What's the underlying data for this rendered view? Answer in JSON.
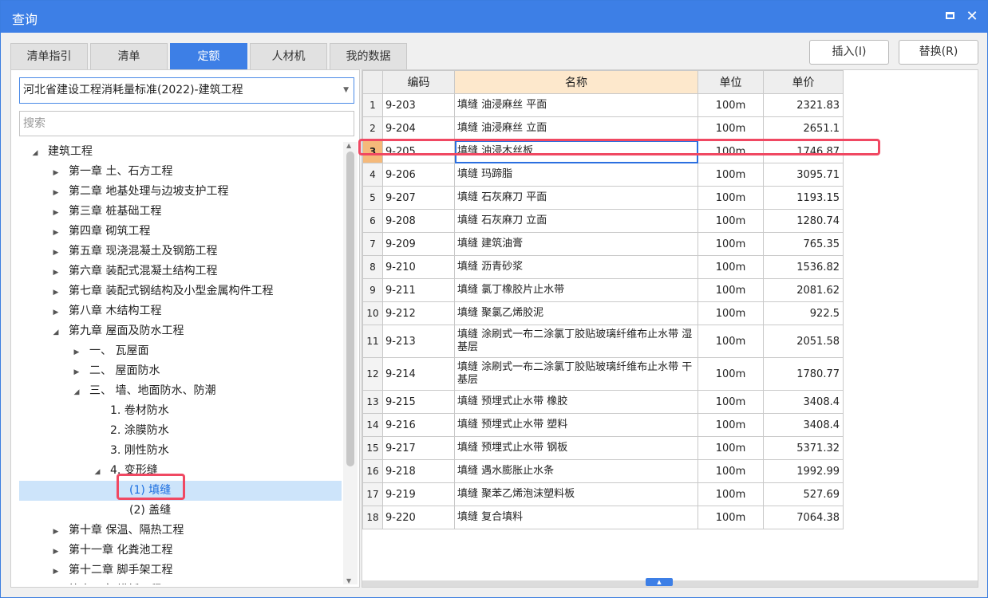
{
  "window": {
    "title": "查询"
  },
  "tabs": [
    {
      "label": "清单指引"
    },
    {
      "label": "清单"
    },
    {
      "label": "定额"
    },
    {
      "label": "人材机"
    },
    {
      "label": "我的数据"
    }
  ],
  "buttons": {
    "insert": "插入(I)",
    "replace": "替换(R)"
  },
  "library_select": {
    "value": "河北省建设工程消耗量标准(2022)-建筑工程"
  },
  "search": {
    "placeholder": "搜索"
  },
  "tree": [
    {
      "label": "建筑工程",
      "level": 0,
      "toggle": "expanded"
    },
    {
      "label": "第一章 土、石方工程",
      "level": 1,
      "toggle": "collapsed"
    },
    {
      "label": "第二章 地基处理与边坡支护工程",
      "level": 1,
      "toggle": "collapsed"
    },
    {
      "label": "第三章 桩基础工程",
      "level": 1,
      "toggle": "collapsed"
    },
    {
      "label": "第四章 砌筑工程",
      "level": 1,
      "toggle": "collapsed"
    },
    {
      "label": "第五章 现浇混凝土及钢筋工程",
      "level": 1,
      "toggle": "collapsed"
    },
    {
      "label": "第六章 装配式混凝土结构工程",
      "level": 1,
      "toggle": "collapsed"
    },
    {
      "label": "第七章 装配式钢结构及小型金属构件工程",
      "level": 1,
      "toggle": "collapsed"
    },
    {
      "label": "第八章 木结构工程",
      "level": 1,
      "toggle": "collapsed"
    },
    {
      "label": "第九章 屋面及防水工程",
      "level": 1,
      "toggle": "expanded"
    },
    {
      "label": "一、 瓦屋面",
      "level": 2,
      "toggle": "collapsed"
    },
    {
      "label": "二、 屋面防水",
      "level": 2,
      "toggle": "collapsed"
    },
    {
      "label": "三、 墙、地面防水、防潮",
      "level": 2,
      "toggle": "expanded"
    },
    {
      "label": "1. 卷材防水",
      "level": 3,
      "toggle": "none"
    },
    {
      "label": "2. 涂膜防水",
      "level": 3,
      "toggle": "none"
    },
    {
      "label": "3. 刚性防水",
      "level": 3,
      "toggle": "none"
    },
    {
      "label": "4. 变形缝",
      "level": 3,
      "toggle": "expanded"
    },
    {
      "label": "(1) 填缝",
      "level": 4,
      "toggle": "none",
      "selected": true
    },
    {
      "label": "(2) 盖缝",
      "level": 4,
      "toggle": "none"
    },
    {
      "label": "第十章 保温、隔热工程",
      "level": 1,
      "toggle": "collapsed"
    },
    {
      "label": "第十一章 化粪池工程",
      "level": 1,
      "toggle": "collapsed"
    },
    {
      "label": "第十二章 脚手架工程",
      "level": 1,
      "toggle": "collapsed"
    },
    {
      "label": "第十三章 模板工程",
      "level": 1,
      "toggle": "collapsed"
    }
  ],
  "grid": {
    "columns": [
      "",
      "编码",
      "名称",
      "单位",
      "单价"
    ],
    "rows": [
      {
        "no": "1",
        "code": "9-203",
        "name": "填缝 油浸麻丝 平面",
        "unit": "100m",
        "price": "2321.83"
      },
      {
        "no": "2",
        "code": "9-204",
        "name": "填缝 油浸麻丝 立面",
        "unit": "100m",
        "price": "2651.1"
      },
      {
        "no": "3",
        "code": "9-205",
        "name": "填缝 油浸木丝板",
        "unit": "100m",
        "price": "1746.87",
        "current": true
      },
      {
        "no": "4",
        "code": "9-206",
        "name": "填缝 玛蹄脂",
        "unit": "100m",
        "price": "3095.71"
      },
      {
        "no": "5",
        "code": "9-207",
        "name": "填缝 石灰麻刀 平面",
        "unit": "100m",
        "price": "1193.15"
      },
      {
        "no": "6",
        "code": "9-208",
        "name": "填缝 石灰麻刀 立面",
        "unit": "100m",
        "price": "1280.74"
      },
      {
        "no": "7",
        "code": "9-209",
        "name": "填缝 建筑油膏",
        "unit": "100m",
        "price": "765.35"
      },
      {
        "no": "8",
        "code": "9-210",
        "name": "填缝 沥青砂浆",
        "unit": "100m",
        "price": "1536.82"
      },
      {
        "no": "9",
        "code": "9-211",
        "name": "填缝 氯丁橡胶片止水带",
        "unit": "100m",
        "price": "2081.62"
      },
      {
        "no": "10",
        "code": "9-212",
        "name": "填缝 聚氯乙烯胶泥",
        "unit": "100m",
        "price": "922.5"
      },
      {
        "no": "11",
        "code": "9-213",
        "name": "填缝 涂刷式一布二涂氯丁胶贴玻璃纤维布止水带 湿基层",
        "unit": "100m",
        "price": "2051.58",
        "tall": true
      },
      {
        "no": "12",
        "code": "9-214",
        "name": "填缝 涂刷式一布二涂氯丁胶贴玻璃纤维布止水带 干基层",
        "unit": "100m",
        "price": "1780.77",
        "tall": true
      },
      {
        "no": "13",
        "code": "9-215",
        "name": "填缝 预埋式止水带 橡胶",
        "unit": "100m",
        "price": "3408.4"
      },
      {
        "no": "14",
        "code": "9-216",
        "name": "填缝 预埋式止水带 塑料",
        "unit": "100m",
        "price": "3408.4"
      },
      {
        "no": "15",
        "code": "9-217",
        "name": "填缝 预埋式止水带 钢板",
        "unit": "100m",
        "price": "5371.32"
      },
      {
        "no": "16",
        "code": "9-218",
        "name": "填缝 遇水膨胀止水条",
        "unit": "100m",
        "price": "1992.99"
      },
      {
        "no": "17",
        "code": "9-219",
        "name": "填缝 聚苯乙烯泡沫塑料板",
        "unit": "100m",
        "price": "527.69"
      },
      {
        "no": "18",
        "code": "9-220",
        "name": "填缝 复合填料",
        "unit": "100m",
        "price": "7064.38"
      }
    ]
  },
  "icons": {
    "maximize": "maximize-icon",
    "close": "close-icon",
    "dropdown": "chevron-down-icon",
    "expanded": "triangle-down-icon",
    "collapsed": "triangle-right-icon"
  },
  "colors": {
    "accent": "#3d7fe6",
    "highlight_box": "#f04862",
    "name_header": "#fde8cc",
    "current_row_marker": "#f5b97a",
    "tree_selected_bg": "#cde4fa"
  }
}
